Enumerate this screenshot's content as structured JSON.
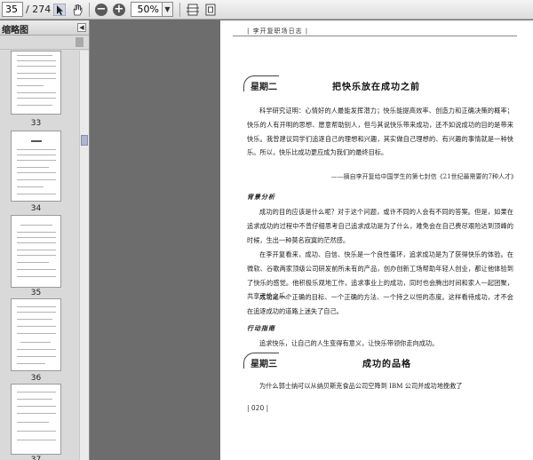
{
  "toolbar": {
    "current_page": "35",
    "total_pages": "/ 274",
    "zoom": "50%"
  },
  "sidebar": {
    "title": "缩略图",
    "thumbnails": [
      {
        "label": "33"
      },
      {
        "label": "34"
      },
      {
        "label": "35"
      },
      {
        "label": "36"
      },
      {
        "label": "37"
      }
    ]
  },
  "page": {
    "running_head": "| 李开复职场日志 |",
    "section1": {
      "tag": "星期二",
      "title": "把快乐放在成功之前"
    },
    "intro": "科学研究证明：心情好的人最能发挥潜力；快乐能提高效率、创造力和正确决策的概率；快乐的人有开明的思想、愿意帮助别人，但与其说快乐带来成功，还不如说成功的目的是带来快乐。我曾建议同学们追逐自己的理想和兴趣，其实做自己理想的、有兴趣的事情就是一种快乐。所以，快乐比成功更应成为我们的最终目标。",
    "quote": "——摘自李开复给中国学生的第七封信《21世纪最需要的7种人才》",
    "background_heading": "背景分析",
    "bg_p1": "成功的目的应该是什么呢？对于这个问题，或许不同的人会有不同的答案。但是，如果在追求成功的过程中不曾仔细思考自己追求成功是为了什么，难免会在自己费尽艰险达到顶峰的时候，生出一种莫名寂寞的茫然感。",
    "bg_p2": "在李开复看来，成功、自信、快乐是一个良性循环，追求成功是为了获得快乐的体验。在微软、谷歌两家顶级公司研发前所未有的产品，创办创新工场帮助年轻人创业，都让他体验到了快乐的感觉。他积极乐观地工作，追求事业上的成功，同时也会腾出时间和家人一起团聚，共享天伦之乐。",
    "bg_p3": "成功是一个正确的目标、一个正确的方法、一个持之以恒的态度。这样看待成功，才不会在追逐成功的道路上迷失了自己。",
    "action_heading": "行动指南",
    "action_text": "追求快乐，让自己的人生变得有意义，让快乐带领你走向成功。",
    "section2": {
      "tag": "星期三",
      "title": "成功的品格"
    },
    "s2_p1": "为什么郭士纳可以从纳贝斯克食品公司空降到 IBM 公司并成功地挽救了",
    "page_number": "| 020 |"
  }
}
